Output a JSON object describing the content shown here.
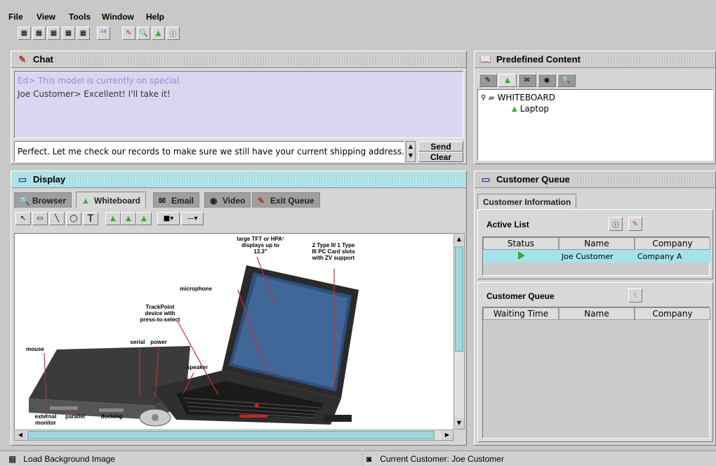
{
  "menu": [
    "File",
    "View",
    "Tools",
    "Window",
    "Help"
  ],
  "toolbar_icons": [
    "layout-1-icon",
    "layout-2-icon",
    "layout-3-icon",
    "layout-4-icon",
    "layout-5-icon",
    "abc-icon",
    "chat-icon",
    "search-icon",
    "image-icon",
    "info-icon"
  ],
  "chat": {
    "title": "Chat",
    "messages": [
      {
        "text": "Ed> This  model is currently on special.",
        "color": "#8b8ee0"
      },
      {
        "text": "Joe Customer> Excellent! I'll take it!",
        "color": "#333333"
      }
    ],
    "input_value": "Perfect. Let me check our records to make sure we still have your current shipping address.",
    "send": "Send",
    "clear": "Clear"
  },
  "predefined": {
    "title": "Predefined Content",
    "tree_root": "WHITEBOARD",
    "tree_child": "Laptop"
  },
  "display": {
    "title": "Display",
    "tabs": [
      "Browser",
      "Whiteboard",
      "Email",
      "Video",
      "Exit Queue"
    ],
    "selected_tab": "Whiteboard",
    "labels": {
      "large_tft": "large TFT or HPA¹ displays up to 13.3\"",
      "pc_card": "2 Type II/ 1 Type III PC Card slots with ZV support",
      "microphone": "microphone",
      "trackpoint": "TrackPoint device with press-to-select",
      "serial": "serial",
      "power": "power",
      "mouse": "mouse",
      "speaker": "speaker",
      "external_monitor": "external monitor",
      "parallel": "parallel",
      "docking": "docking"
    }
  },
  "queue": {
    "title": "Customer Queue",
    "tab": "Customer Information",
    "active_list": {
      "title": "Active List",
      "headers": [
        "Status",
        "Name",
        "Company"
      ],
      "rows": [
        {
          "name": "Joe Customer",
          "company": "Company A"
        }
      ]
    },
    "customer_queue": {
      "title": "Customer Queue",
      "headers": [
        "Waiting Time",
        "Name",
        "Company"
      ]
    }
  },
  "status_bar": {
    "left": "Load Background Image",
    "right": "Current Customer: Joe Customer"
  }
}
